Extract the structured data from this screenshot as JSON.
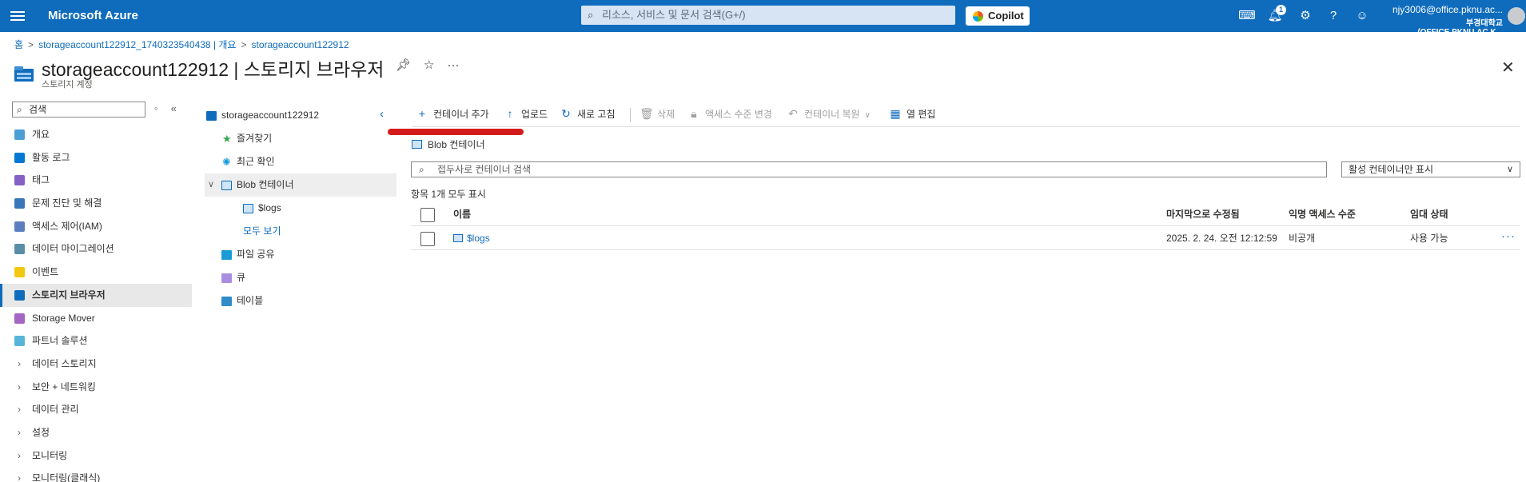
{
  "topbar": {
    "brand": "Microsoft Azure",
    "search_placeholder": "리소스, 서비스 및 문서 검색(G+/)",
    "copilot": "Copilot",
    "notification_count": "1",
    "user_email": "njy3006@office.pknu.ac...",
    "user_org": "부경대학교(OFFICE.PKNU.AC.K..."
  },
  "breadcrumb": [
    "홈",
    "storageaccount122912_1740323540438 | 개요",
    "storageaccount122912"
  ],
  "page": {
    "title": "storageaccount122912 | 스토리지 브라우저",
    "subtitle": "스토리지 계정"
  },
  "nav": {
    "search_placeholder": "검색",
    "items": [
      {
        "label": "개요",
        "color": "#4b9fd5",
        "type": "icon"
      },
      {
        "label": "활동 로그",
        "color": "#0078d4",
        "type": "icon"
      },
      {
        "label": "태그",
        "color": "#8661c5",
        "type": "icon"
      },
      {
        "label": "문제 진단 및 해결",
        "color": "#3a77b8",
        "type": "icon"
      },
      {
        "label": "액세스 제어(IAM)",
        "color": "#5b7fbf",
        "type": "icon"
      },
      {
        "label": "데이터 마이그레이션",
        "color": "#5a8ea8",
        "type": "icon"
      },
      {
        "label": "이벤트",
        "color": "#f2c811",
        "type": "icon"
      },
      {
        "label": "스토리지 브라우저",
        "color": "#0f6cbd",
        "type": "icon",
        "active": true
      },
      {
        "label": "Storage Mover",
        "color": "#a366c4",
        "type": "icon"
      },
      {
        "label": "파트너 솔루션",
        "color": "#59b4d9",
        "type": "icon"
      },
      {
        "label": "데이터 스토리지",
        "type": "group"
      },
      {
        "label": "보안 + 네트워킹",
        "type": "group"
      },
      {
        "label": "데이터 관리",
        "type": "group"
      },
      {
        "label": "설정",
        "type": "group"
      },
      {
        "label": "모니터링",
        "type": "group"
      },
      {
        "label": "모니터링(클래식)",
        "type": "group"
      }
    ]
  },
  "tree": {
    "root": "storageaccount122912",
    "favorites": "즐겨찾기",
    "recent": "최근 확인",
    "blob_containers": "Blob 컨테이너",
    "logs": "$logs",
    "see_all": "모두 보기",
    "file_shares": "파일 공유",
    "queues": "큐",
    "tables": "테이블"
  },
  "toolbar": {
    "add_container": "컨테이너 추가",
    "upload": "업로드",
    "refresh": "새로 고침",
    "delete": "삭제",
    "change_access": "액세스 수준 변경",
    "restore_container": "컨테이너 복원",
    "edit_columns": "열 편집"
  },
  "content": {
    "section_label": "Blob 컨테이너",
    "filter_placeholder": "접두사로 컨테이너 검색",
    "status_filter": "활성 컨테이너만 표시",
    "count_text": "항목 1개 모두 표시",
    "columns": [
      "이름",
      "마지막으로 수정됨",
      "익명 액세스 수준",
      "임대 상태"
    ],
    "rows": [
      {
        "name": "$logs",
        "modified": "2025. 2. 24. 오전 12:12:59",
        "access": "비공개",
        "lease": "사용 가능"
      }
    ]
  }
}
